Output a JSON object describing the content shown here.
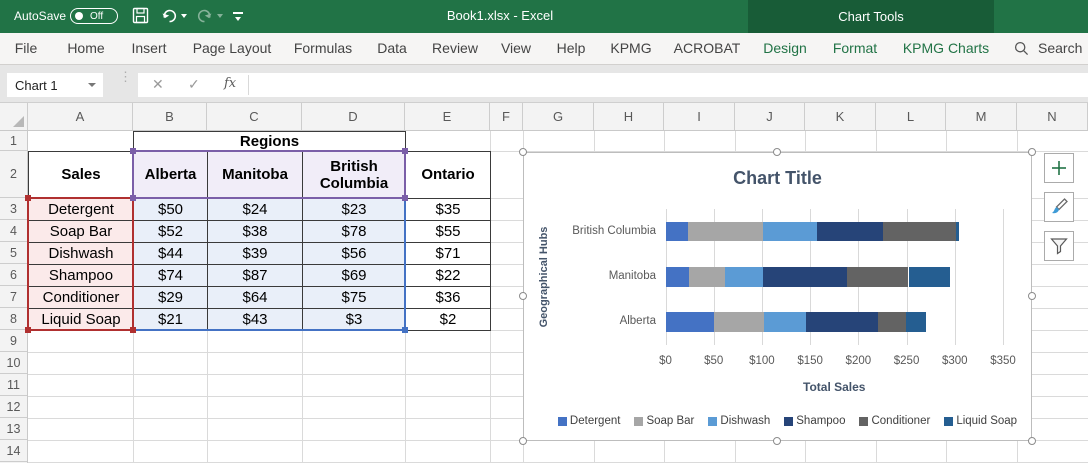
{
  "titlebar": {
    "autosave_label": "AutoSave",
    "autosave_state": "Off",
    "window_title": "Book1.xlsx - Excel",
    "contextual_tab_group": "Chart Tools",
    "colors": {
      "titlebar_bg": "#217346",
      "contextual_bg": "#185C37"
    }
  },
  "ribbon": {
    "tabs": [
      {
        "label": "File",
        "contextual": false
      },
      {
        "label": "Home",
        "contextual": false
      },
      {
        "label": "Insert",
        "contextual": false
      },
      {
        "label": "Page Layout",
        "contextual": false
      },
      {
        "label": "Formulas",
        "contextual": false
      },
      {
        "label": "Data",
        "contextual": false
      },
      {
        "label": "Review",
        "contextual": false
      },
      {
        "label": "View",
        "contextual": false
      },
      {
        "label": "Help",
        "contextual": false
      },
      {
        "label": "KPMG",
        "contextual": false
      },
      {
        "label": "ACROBAT",
        "contextual": false
      },
      {
        "label": "Design",
        "contextual": true
      },
      {
        "label": "Format",
        "contextual": true
      },
      {
        "label": "KPMG Charts",
        "contextual": true
      }
    ],
    "search_label": "Search"
  },
  "formula_bar": {
    "name_box_value": "Chart 1",
    "formula_value": ""
  },
  "grid": {
    "column_letters": [
      "A",
      "B",
      "C",
      "D",
      "E",
      "F",
      "G",
      "H",
      "I",
      "J",
      "K",
      "L",
      "M",
      "N"
    ],
    "row_numbers": [
      "1",
      "2",
      "3",
      "4",
      "5",
      "6",
      "7",
      "8",
      "9",
      "10",
      "11",
      "12",
      "13",
      "14"
    ]
  },
  "table": {
    "merged_header": "Regions",
    "header_row": [
      "Sales",
      "Alberta",
      "Manitoba",
      "British Columbia",
      "Ontario"
    ],
    "rows": [
      [
        "Detergent",
        "$50",
        "$24",
        "$23",
        "$35"
      ],
      [
        "Soap Bar",
        "$52",
        "$38",
        "$78",
        "$55"
      ],
      [
        "Dishwash",
        "$44",
        "$39",
        "$56",
        "$71"
      ],
      [
        "Shampoo",
        "$74",
        "$87",
        "$69",
        "$22"
      ],
      [
        "Conditioner",
        "$29",
        "$64",
        "$75",
        "$36"
      ],
      [
        "Liquid Soap",
        "$21",
        "$43",
        "$3",
        "$2"
      ]
    ],
    "fills": {
      "category_col": "#FBEAEA",
      "header_cells": "#F1EDF8",
      "value_cells": "#E9EFF9"
    },
    "selection_colors": {
      "categories": "#B03030",
      "headers": "#7B5FA8",
      "values": "#4472C4"
    }
  },
  "chart_data": {
    "type": "bar",
    "stacked": true,
    "horizontal": true,
    "title": "Chart Title",
    "xlabel": "Total Sales",
    "ylabel": "Geographical Hubs",
    "categories": [
      "British Columbia",
      "Manitoba",
      "Alberta"
    ],
    "series": [
      {
        "name": "Detergent",
        "color": "#4472C4",
        "values": [
          23,
          24,
          50
        ]
      },
      {
        "name": "Soap Bar",
        "color": "#A6A6A6",
        "values": [
          78,
          38,
          52
        ]
      },
      {
        "name": "Dishwash",
        "color": "#5B9BD5",
        "values": [
          56,
          39,
          44
        ]
      },
      {
        "name": "Shampoo",
        "color": "#264478",
        "values": [
          69,
          87,
          74
        ]
      },
      {
        "name": "Conditioner",
        "color": "#636363",
        "values": [
          75,
          64,
          29
        ]
      },
      {
        "name": "Liquid Soap",
        "color": "#255E91",
        "values": [
          3,
          43,
          21
        ]
      }
    ],
    "xlim": [
      0,
      350
    ],
    "xtick_step": 50,
    "tick_prefix": "$",
    "legend_position": "bottom",
    "grid": true
  },
  "chart_buttons": [
    {
      "name": "chart-elements"
    },
    {
      "name": "chart-styles"
    },
    {
      "name": "chart-filters"
    }
  ]
}
